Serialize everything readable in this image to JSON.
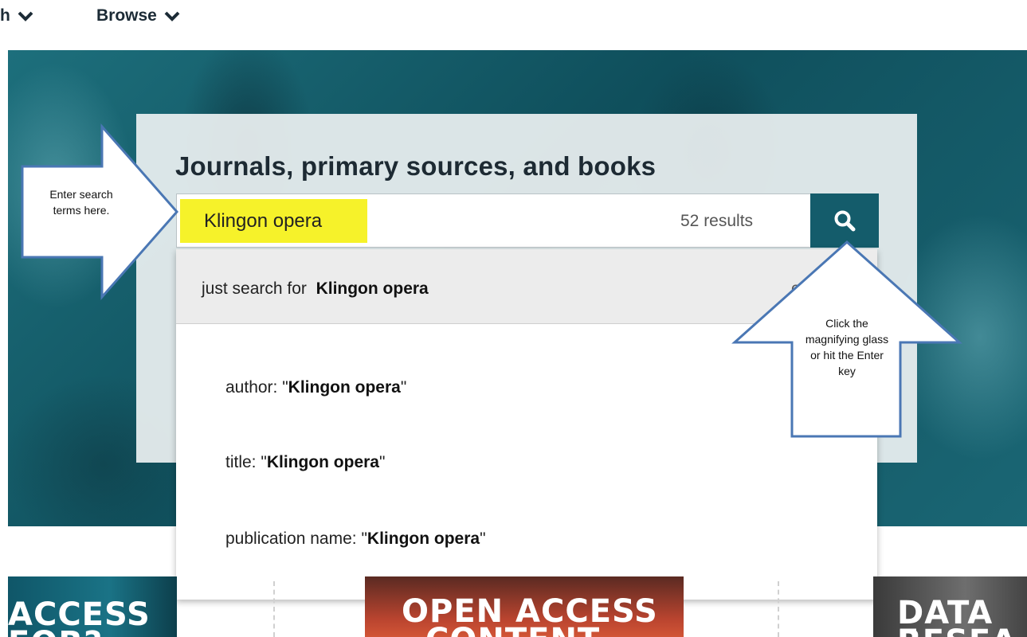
{
  "nav": {
    "items": [
      {
        "label": "h"
      },
      {
        "label": "Browse"
      }
    ]
  },
  "hero": {
    "title": "Journals, primary sources, and books"
  },
  "search": {
    "query": "Klingon opera",
    "result_count": "52 results",
    "button_icon": "magnifying-glass-icon",
    "highlight_color": "#f6f22a",
    "button_color": "#145c6b"
  },
  "suggestions": {
    "primary_prefix": "just search for",
    "primary_term": "Klingon opera",
    "primary_trailing": "e",
    "items": [
      {
        "prefix": "author: \"",
        "term": "Klingon opera",
        "suffix": "\""
      },
      {
        "prefix": "title: \"",
        "term": "Klingon opera",
        "suffix": "\""
      },
      {
        "prefix": "publication name: \"",
        "term": "Klingon opera",
        "suffix": "\""
      }
    ]
  },
  "tiles": [
    {
      "line1": "ACCESS",
      "line2": "FOR?"
    },
    {
      "line1": "OPEN ACCESS",
      "line2": "CONTENT"
    },
    {
      "line1": "DATA F",
      "line2": "RESEA"
    }
  ],
  "callouts": {
    "left": "Enter search terms here.",
    "right": "Click the magnifying glass or hit the Enter key"
  }
}
